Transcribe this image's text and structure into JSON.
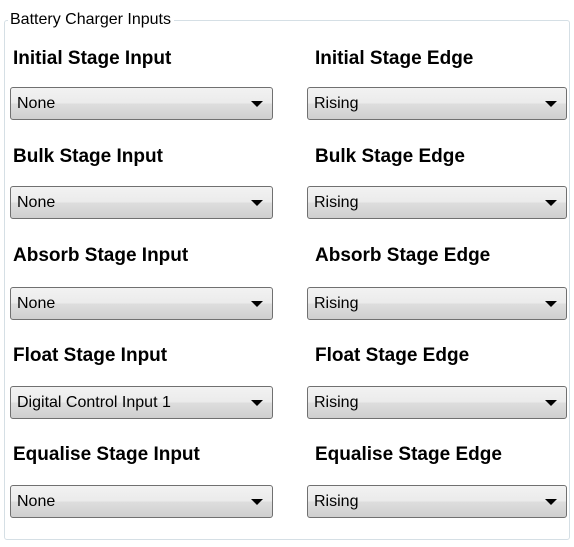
{
  "group": {
    "title": "Battery Charger Inputs"
  },
  "rows": [
    {
      "input_label": "Initial Stage Input",
      "input_value": "None",
      "edge_label": "Initial Stage Edge",
      "edge_value": "Rising"
    },
    {
      "input_label": "Bulk Stage Input",
      "input_value": "None",
      "edge_label": "Bulk Stage Edge",
      "edge_value": "Rising"
    },
    {
      "input_label": "Absorb Stage Input",
      "input_value": "None",
      "edge_label": "Absorb Stage Edge",
      "edge_value": "Rising"
    },
    {
      "input_label": "Float Stage Input",
      "input_value": "Digital Control Input 1",
      "edge_label": "Float Stage Edge",
      "edge_value": "Rising"
    },
    {
      "input_label": "Equalise Stage Input",
      "input_value": "None",
      "edge_label": "Equalise Stage Edge",
      "edge_value": "Rising"
    }
  ],
  "icons": {
    "dropdown": "chevron-down-icon"
  }
}
